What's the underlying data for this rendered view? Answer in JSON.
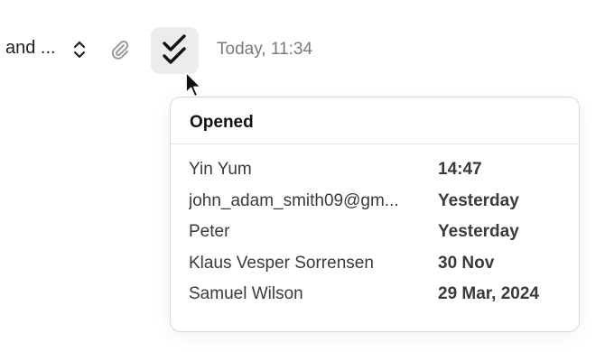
{
  "toolbar": {
    "subject_preview": "and ...",
    "sort_icon": "chevron-up-down-icon",
    "attach_icon": "paperclip-icon",
    "read_icon": "double-check-icon",
    "timestamp": "Today, 11:34"
  },
  "popover": {
    "title": "Opened",
    "rows": [
      {
        "name": "Yin Yum",
        "time": "14:47"
      },
      {
        "name": "john_adam_smith09@gm...",
        "time": "Yesterday"
      },
      {
        "name": "Peter",
        "time": "Yesterday"
      },
      {
        "name": "Klaus Vesper Sorrensen",
        "time": "30 Nov"
      },
      {
        "name": "Samuel Wilson",
        "time": "29 Mar, 2024"
      }
    ]
  },
  "colors": {
    "button_bg": "#ececec",
    "muted_text": "#7a7a7a",
    "border": "#d9d9d9"
  }
}
